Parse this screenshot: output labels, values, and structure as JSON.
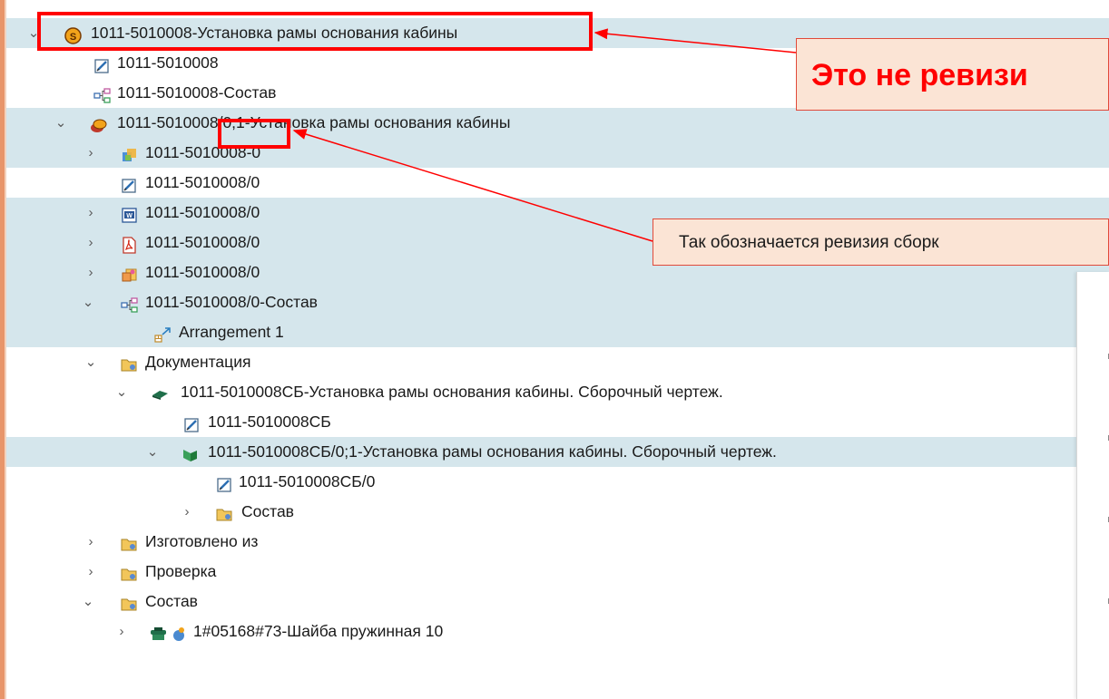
{
  "tree": {
    "rows": [
      {
        "label": "1011-5010008-Установка рамы основания кабины",
        "icon": "item-icon"
      },
      {
        "label": "1011-5010008",
        "icon": "form-icon"
      },
      {
        "label": "1011-5010008-Состав",
        "icon": "structure-icon"
      },
      {
        "label": "1011-5010008/0;1-Установка рамы основания кабины",
        "icon": "revision-icon"
      },
      {
        "label": "1011-5010008-0",
        "icon": "model-icon"
      },
      {
        "label": "1011-5010008/0",
        "icon": "form-icon"
      },
      {
        "label": "1011-5010008/0",
        "icon": "word-doc-icon"
      },
      {
        "label": "1011-5010008/0",
        "icon": "pdf-icon"
      },
      {
        "label": "1011-5010008/0",
        "icon": "dataset-icon"
      },
      {
        "label": "1011-5010008/0-Состав",
        "icon": "structure-icon"
      },
      {
        "label": "Arrangement 1",
        "icon": "arrangement-icon"
      },
      {
        "label": "Документация",
        "icon": "folder-icon"
      },
      {
        "label": "1011-5010008СБ-Установка рамы основания кабины. Сборочный чертеж.",
        "icon": "drawing-item-icon"
      },
      {
        "label": "1011-5010008СБ",
        "icon": "form-icon"
      },
      {
        "label": "1011-5010008СБ/0;1-Установка рамы основания кабины. Сборочный чертеж.",
        "icon": "drawing-revision-icon"
      },
      {
        "label": "1011-5010008СБ/0",
        "icon": "form-icon"
      },
      {
        "label": "Состав",
        "icon": "folder-icon"
      },
      {
        "label": "Изготовлено из",
        "icon": "folder-icon"
      },
      {
        "label": "Проверка",
        "icon": "folder-icon"
      },
      {
        "label": "Состав",
        "icon": "folder-icon"
      },
      {
        "label": "1#05168#73-Шайба пружинная 10",
        "icon": "part-icon"
      }
    ]
  },
  "annotations": {
    "callout_not_revision": "Это не ревизи",
    "callout_revision_note": "Так обозначается ревизия сборк"
  },
  "colors": {
    "highlight": "#ff0000",
    "selected_row": "#d5e6ec",
    "callout_bg": "#fbe4d5"
  }
}
